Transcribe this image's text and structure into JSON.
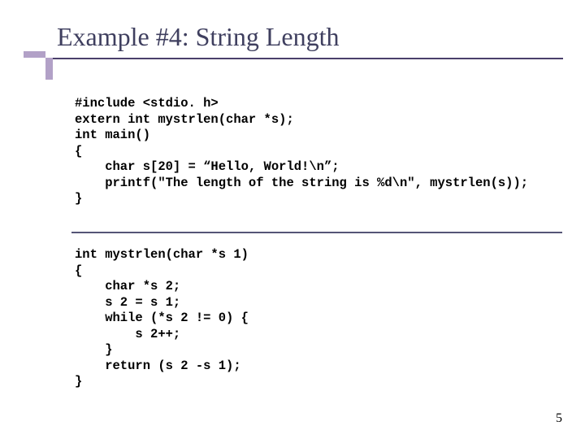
{
  "title": "Example #4: String Length",
  "code_block_1": "#include <stdio. h>\nextern int mystrlen(char *s);\nint main()\n{\n    char s[20] = “Hello, World!\\n”;\n    printf(\"The length of the string is %d\\n\", mystrlen(s));\n}",
  "code_block_2": "int mystrlen(char *s 1)\n{\n    char *s 2;\n    s 2 = s 1;\n    while (*s 2 != 0) {\n        s 2++;\n    }\n    return (s 2 -s 1);\n}",
  "page_number": "5"
}
